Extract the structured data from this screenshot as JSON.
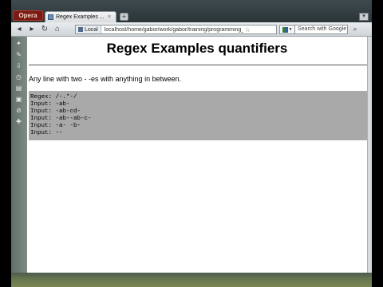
{
  "tab": {
    "title": "Regex Examples ...",
    "close": "×",
    "new_tab": "+"
  },
  "app": {
    "logo": "Opera"
  },
  "window": {
    "control": "▾"
  },
  "nav": {
    "back": "◂",
    "forward": "▸",
    "reload": "↻",
    "home": "⌂"
  },
  "urlbar": {
    "site_label": "Local",
    "url": "localhost/home/gabor/work/gabor/training/programming_pe",
    "star": "☆"
  },
  "search": {
    "placeholder": "Search with Google",
    "go": "⌕"
  },
  "page": {
    "title": "Regex Examples quantifiers",
    "description": "Any line with two - -es with anything in between.",
    "code_lines": [
      "Regex: /-.*-/",
      "Input: -ab-",
      "Input: -ab-cd-",
      "Input: -ab--ab-c-",
      "Input: -a- -b-",
      "Input: --"
    ]
  },
  "icons": {
    "sidebar": [
      "bookmarks-icon",
      "notes-icon",
      "downloads-icon",
      "history-icon",
      "transfers-icon",
      "panel-icon",
      "links-icon",
      "add-panel-icon"
    ]
  },
  "colors": {
    "code_bg": "#a9a9a9",
    "tab_bar": "#2b3538"
  }
}
